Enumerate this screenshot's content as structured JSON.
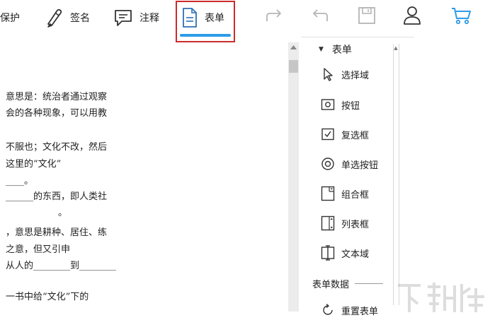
{
  "toolbar": {
    "protect_label": "保护",
    "sign_label": "签名",
    "annotate_label": "注释",
    "form_label": "表单"
  },
  "icons": {
    "redo": "redo-icon",
    "undo": "undo-icon",
    "save": "save-icon",
    "user": "user-icon",
    "cart": "cart-icon"
  },
  "colors": {
    "active_underline": "#2d9be8",
    "highlight_border": "#cc2a2a",
    "cart": "#2d9be8"
  },
  "document": {
    "lines": [
      "意思是：统治者通过观察",
      "会的各种现象，可以用教",
      "不服也；文化不改，然后",
      "这里的“文化”",
      "____。",
      "______的东西，即人类社",
      "。",
      "，意思是耕种、居住、练",
      "之意，但又引申",
      "从人的________到________",
      "一书中给“文化”下的"
    ]
  },
  "panel": {
    "section_title": "表单",
    "tools": [
      {
        "label": "选择域",
        "icon": "cursor-icon"
      },
      {
        "label": "按钮",
        "icon": "button-icon"
      },
      {
        "label": "复选框",
        "icon": "checkbox-icon"
      },
      {
        "label": "单选按钮",
        "icon": "radio-icon"
      },
      {
        "label": "组合框",
        "icon": "combobox-icon"
      },
      {
        "label": "列表框",
        "icon": "listbox-icon"
      },
      {
        "label": "文本域",
        "icon": "textfield-icon"
      }
    ],
    "data_section_title": "表单数据",
    "data_tools": [
      {
        "label": "重置表单",
        "icon": "reset-icon"
      }
    ]
  }
}
